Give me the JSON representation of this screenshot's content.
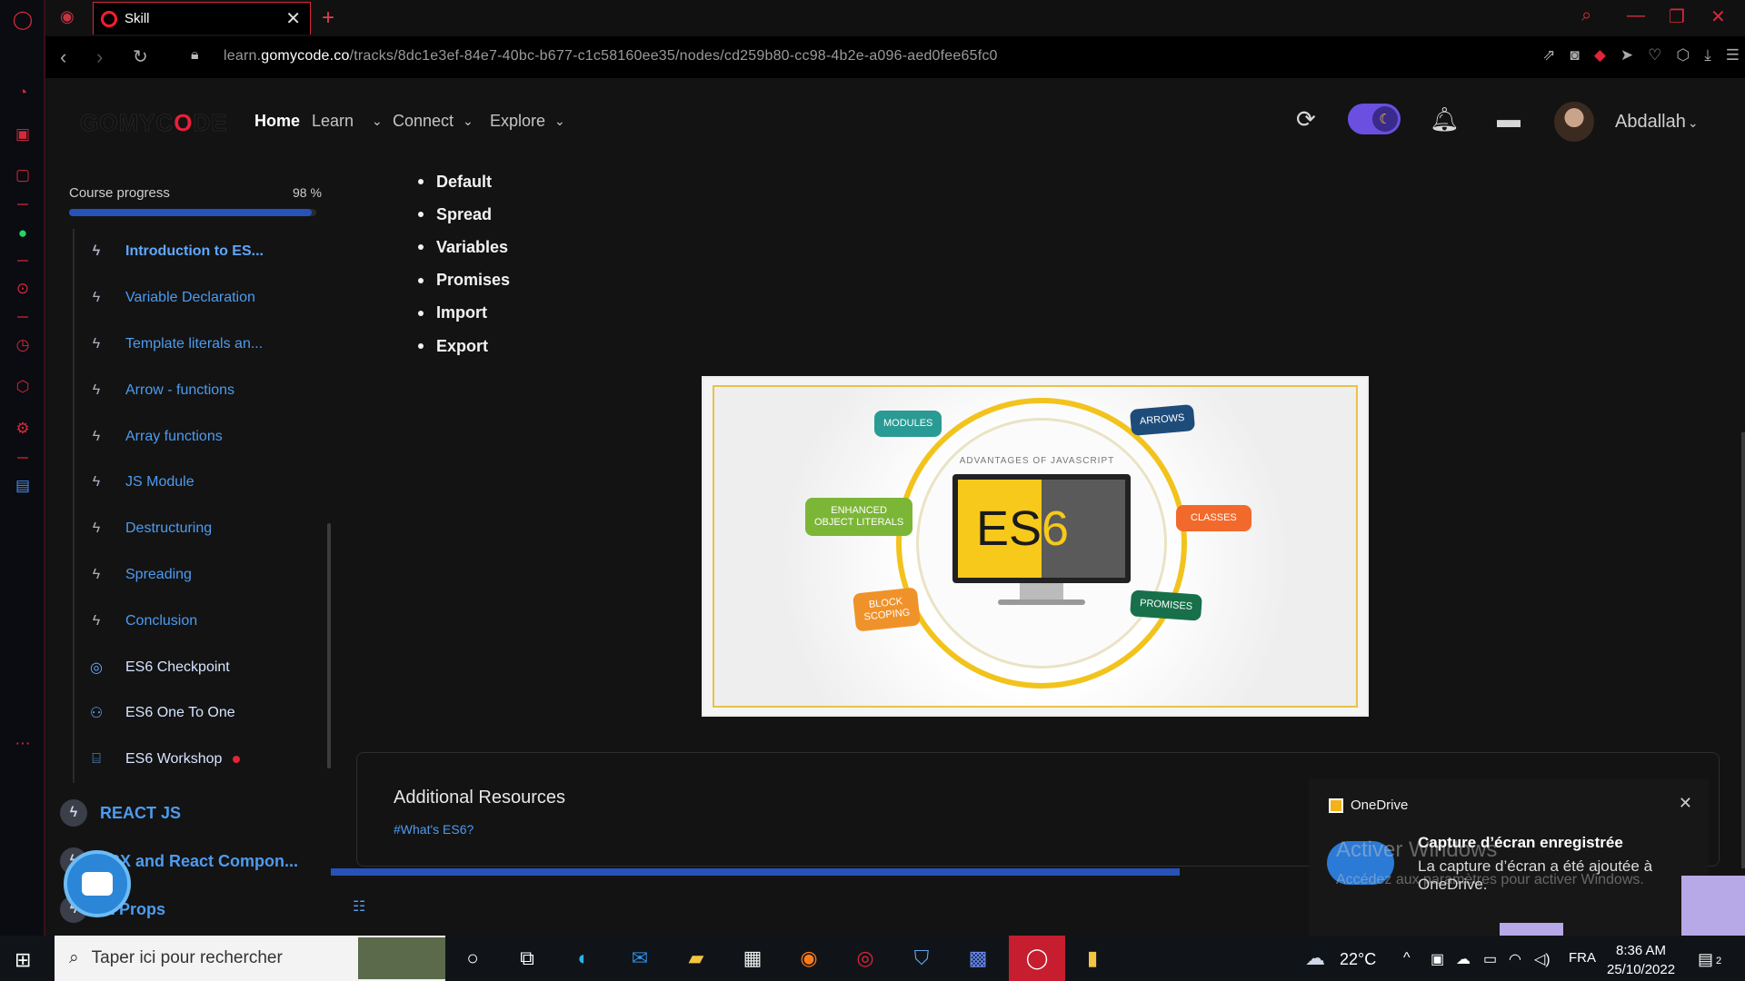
{
  "browser": {
    "tab_title": "Skill",
    "url_prefix": "learn.",
    "url_domain": "gomycode.co",
    "url_path": "/tracks/8dc1e3ef-84e7-40bc-b677-c1c58160ee35/nodes/cd259b80-cc98-4b2e-a096-aed0fee65fc0"
  },
  "header": {
    "logo_left": "GOMYC",
    "logo_red": "O",
    "logo_right": "DE",
    "nav": [
      {
        "label": "Home"
      },
      {
        "label": "Learn"
      },
      {
        "label": "Connect"
      },
      {
        "label": "Explore"
      }
    ],
    "username": "Abdallah"
  },
  "course": {
    "progress_label": "Course progress",
    "progress_text": "98 %",
    "progress_value": 98,
    "lessons": [
      {
        "label": "Introduction to ES..."
      },
      {
        "label": "Variable Declaration"
      },
      {
        "label": "Template literals an..."
      },
      {
        "label": "Arrow - functions"
      },
      {
        "label": "Array functions"
      },
      {
        "label": "JS Module"
      },
      {
        "label": "Destructuring"
      },
      {
        "label": "Spreading"
      },
      {
        "label": "Conclusion"
      },
      {
        "label": "ES6 Checkpoint"
      },
      {
        "label": "ES6 One To One"
      },
      {
        "label": "ES6 Workshop"
      }
    ],
    "modules": [
      {
        "label": "REACT JS"
      },
      {
        "label": "JSX and React Compon..."
      },
      {
        "label": "ct Props"
      }
    ]
  },
  "content": {
    "bullets": [
      "Default",
      "Spread",
      "Variables",
      "Promises",
      "Import",
      "Export"
    ],
    "image": {
      "heading": "ADVANTAGES OF JAVASCRIPT",
      "es": "ES",
      "six": "6",
      "modules": "MODULES",
      "arrows": "ARROWS",
      "enhanced_1": "ENHANCED",
      "enhanced_2": "OBJECT LITERALS",
      "classes": "CLASSES",
      "block_1": "BLOCK",
      "block_2": "SCOPING",
      "promises": "PROMISES"
    },
    "resources_title": "Additional Resources",
    "resources_link": "#What's ES6?"
  },
  "notification": {
    "app": "OneDrive",
    "title": "Capture d’écran enregistrée",
    "body": "La capture d’écran a été ajoutée à OneDrive."
  },
  "watermark": {
    "title": "Activer Windows",
    "subtitle": "Accédez aux paramètres pour activer Windows."
  },
  "taskbar": {
    "search_placeholder": "Taper ici pour rechercher",
    "temperature": "22°C",
    "language": "FRA",
    "time": "8:36 AM",
    "date": "25/10/2022",
    "notif_count": "2"
  },
  "colors": {
    "accent_blue": "#2752b7",
    "link_blue": "#4d9bf0",
    "opera_red": "#d6293a",
    "es6_yellow": "#f7c91a"
  }
}
